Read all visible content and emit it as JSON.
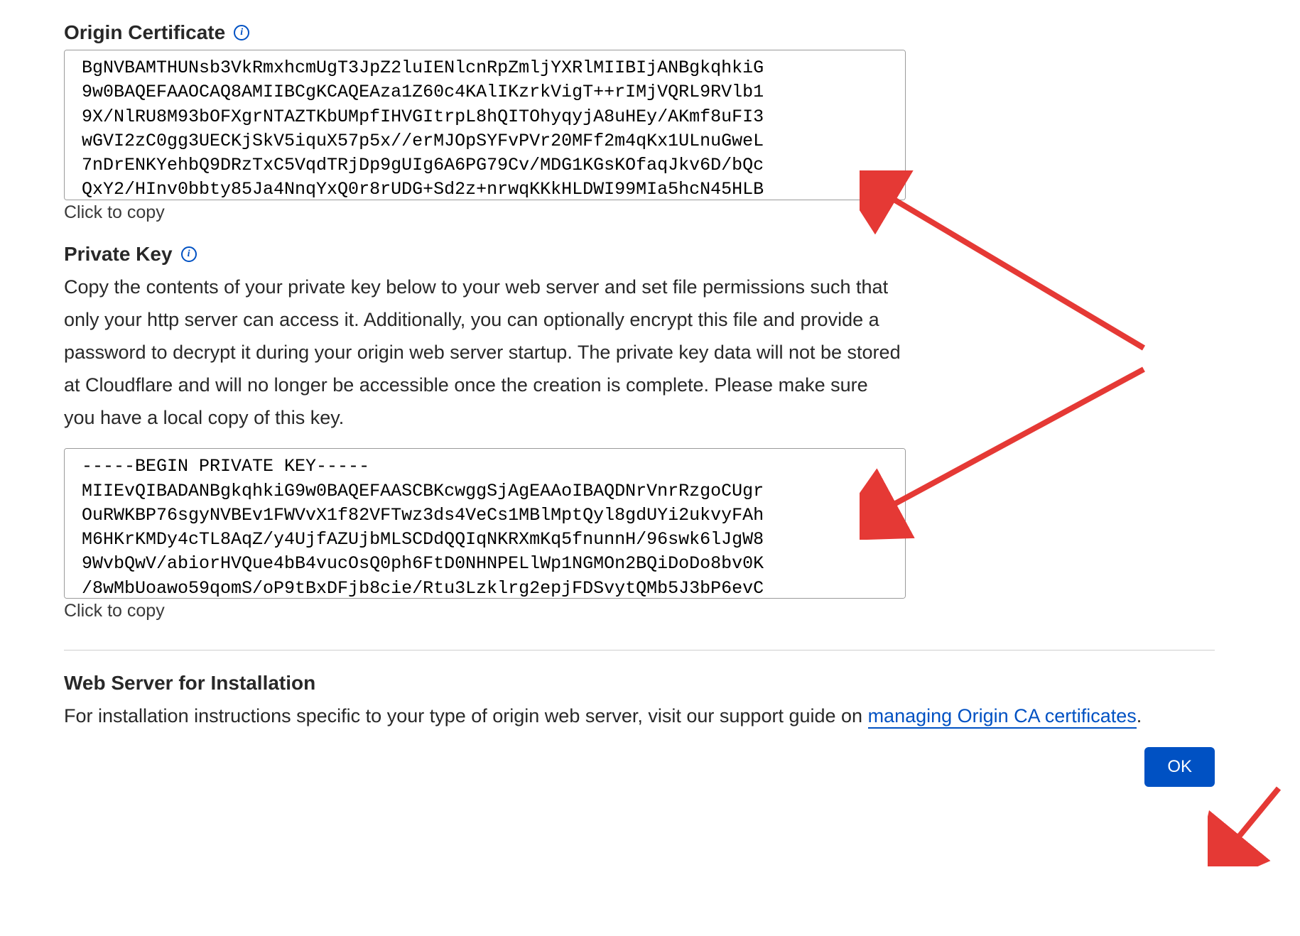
{
  "origin_cert": {
    "heading": "Origin Certificate",
    "content": "BgNVBAMTHUNsb3VkRmxhcmUgT3JpZ2luIENlcnRpZmljYXRlMIIBIjANBgkqhkiG\n9w0BAQEFAAOCAQ8AMIIBCgKCAQEAza1Z60c4KAlIKzrkVigT++rIMjVQRL9RVlb1\n9X/NlRU8M93bOFXgrNTAZTKbUMpfIHVGItrpL8hQITOhyqyjA8uHEy/AKmf8uFI3\nwGVI2zC0gg3UECKjSkV5iquX57p5x//erMJOpSYFvPVr20MFf2m4qKx1ULnuGweL\n7nDrENKYehbQ9DRzTxC5VqdTRjDp9gUIg6A6PG79Cv/MDG1KGsKOfaqJkv6D/bQc\nQxY2/HInv0bbty85Ja4NnqYxQ0r8rUDG+Sd2z+nrwqKKkHLDWI99MIa5hcN45HLB",
    "copy_hint": "Click to copy"
  },
  "private_key": {
    "heading": "Private Key",
    "description": "Copy the contents of your private key below to your web server and set file permissions such that only your http server can access it. Additionally, you can optionally encrypt this file and provide a password to decrypt it during your origin web server startup. The private key data will not be stored at Cloudflare and will no longer be accessible once the creation is complete. Please make sure you have a local copy of this key.",
    "content": "-----BEGIN PRIVATE KEY-----\nMIIEvQIBADANBgkqhkiG9w0BAQEFAASCBKcwggSjAgEAAoIBAQDNrVnrRzgoCUgr\nOuRWKBP76sgyNVBEv1FWVvX1f82VFTwz3ds4VeCs1MBlMptQyl8gdUYi2ukvyFAh\nM6HKrKMDy4cTL8AqZ/y4UjfAZUjbMLSCDdQQIqNKRXmKq5fnunnH/96swk6lJgW8\n9WvbQwV/abiorHVQue4bB4vucOsQ0ph6FtD0NHNPELlWp1NGMOn2BQiDoDo8bv0K\n/8wMbUoawo59qomS/oP9tBxDFjb8cie/Rtu3Lzklrg2epjFDSvytQMb5J3bP6evC",
    "copy_hint": "Click to copy"
  },
  "web_server": {
    "heading": "Web Server for Installation",
    "description_pre": "For installation instructions specific to your type of origin web server, visit our support guide on ",
    "link_text": "managing Origin CA certificates",
    "description_post": "."
  },
  "ok_label": "OK",
  "colors": {
    "accent": "#0051c3",
    "arrow": "#e53935"
  }
}
